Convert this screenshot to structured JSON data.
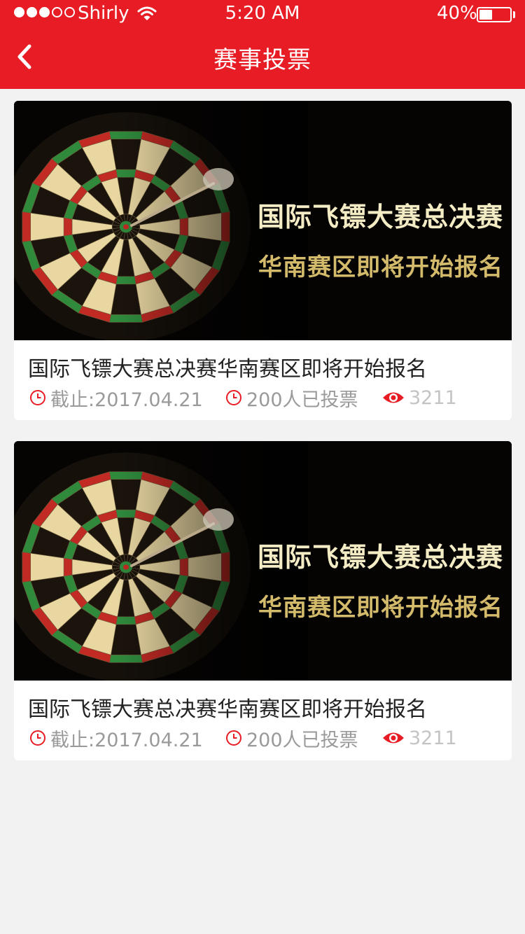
{
  "status_bar": {
    "carrier": "Shirly",
    "time": "5:20 AM",
    "battery": "40%"
  },
  "header": {
    "title": "赛事投票"
  },
  "colors": {
    "brand": "#e81c24",
    "background": "#f2f2f2",
    "meta_text": "#9a9a9a"
  },
  "events": [
    {
      "banner_line1": "国际飞镖大赛总决赛",
      "banner_line2": "华南赛区即将开始报名",
      "title": "国际飞镖大赛总决赛华南赛区即将开始报名",
      "deadline": "截止:2017.04.21",
      "votes": "200人已投票",
      "views": "3211"
    },
    {
      "banner_line1": "国际飞镖大赛总决赛",
      "banner_line2": "华南赛区即将开始报名",
      "title": "国际飞镖大赛总决赛华南赛区即将开始报名",
      "deadline": "截止:2017.04.21",
      "votes": "200人已投票",
      "views": "3211"
    }
  ]
}
